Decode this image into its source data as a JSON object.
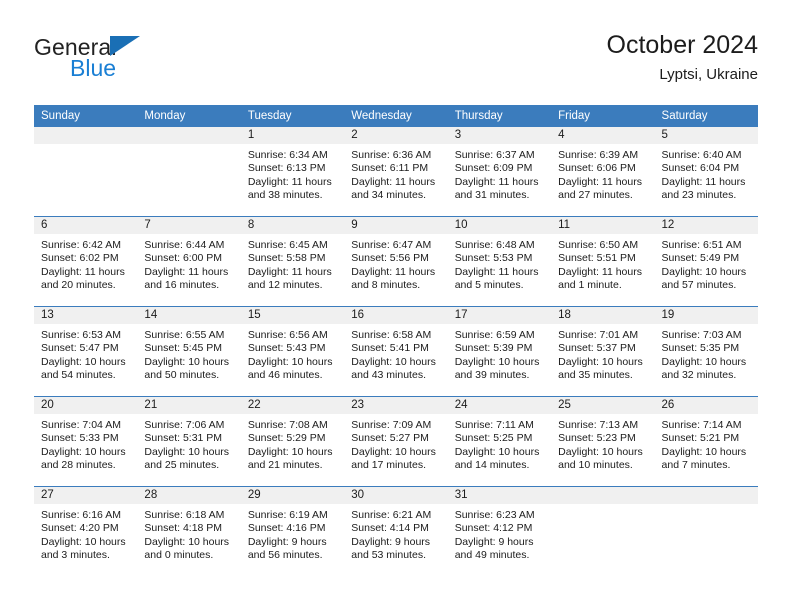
{
  "brand": {
    "name_top": "General",
    "name_bottom": "Blue",
    "triangle_color": "#1a6fb5",
    "blue_text_color": "#1a7fd4"
  },
  "header": {
    "title": "October 2024",
    "subtitle": "Lyptsi, Ukraine"
  },
  "theme": {
    "header_blue": "#3b7cbd",
    "daynum_band": "#f0f0f0",
    "text": "#1c1c1c"
  },
  "calendar": {
    "weekday_headers": [
      "Sunday",
      "Monday",
      "Tuesday",
      "Wednesday",
      "Thursday",
      "Friday",
      "Saturday"
    ],
    "labels": {
      "sunrise": "Sunrise:",
      "sunset": "Sunset:",
      "daylight": "Daylight:"
    },
    "weeks": [
      [
        {
          "day": ""
        },
        {
          "day": ""
        },
        {
          "day": "1",
          "sunrise": "Sunrise: 6:34 AM",
          "sunset": "Sunset: 6:13 PM",
          "daylight": "Daylight: 11 hours and 38 minutes."
        },
        {
          "day": "2",
          "sunrise": "Sunrise: 6:36 AM",
          "sunset": "Sunset: 6:11 PM",
          "daylight": "Daylight: 11 hours and 34 minutes."
        },
        {
          "day": "3",
          "sunrise": "Sunrise: 6:37 AM",
          "sunset": "Sunset: 6:09 PM",
          "daylight": "Daylight: 11 hours and 31 minutes."
        },
        {
          "day": "4",
          "sunrise": "Sunrise: 6:39 AM",
          "sunset": "Sunset: 6:06 PM",
          "daylight": "Daylight: 11 hours and 27 minutes."
        },
        {
          "day": "5",
          "sunrise": "Sunrise: 6:40 AM",
          "sunset": "Sunset: 6:04 PM",
          "daylight": "Daylight: 11 hours and 23 minutes."
        }
      ],
      [
        {
          "day": "6",
          "sunrise": "Sunrise: 6:42 AM",
          "sunset": "Sunset: 6:02 PM",
          "daylight": "Daylight: 11 hours and 20 minutes."
        },
        {
          "day": "7",
          "sunrise": "Sunrise: 6:44 AM",
          "sunset": "Sunset: 6:00 PM",
          "daylight": "Daylight: 11 hours and 16 minutes."
        },
        {
          "day": "8",
          "sunrise": "Sunrise: 6:45 AM",
          "sunset": "Sunset: 5:58 PM",
          "daylight": "Daylight: 11 hours and 12 minutes."
        },
        {
          "day": "9",
          "sunrise": "Sunrise: 6:47 AM",
          "sunset": "Sunset: 5:56 PM",
          "daylight": "Daylight: 11 hours and 8 minutes."
        },
        {
          "day": "10",
          "sunrise": "Sunrise: 6:48 AM",
          "sunset": "Sunset: 5:53 PM",
          "daylight": "Daylight: 11 hours and 5 minutes."
        },
        {
          "day": "11",
          "sunrise": "Sunrise: 6:50 AM",
          "sunset": "Sunset: 5:51 PM",
          "daylight": "Daylight: 11 hours and 1 minute."
        },
        {
          "day": "12",
          "sunrise": "Sunrise: 6:51 AM",
          "sunset": "Sunset: 5:49 PM",
          "daylight": "Daylight: 10 hours and 57 minutes."
        }
      ],
      [
        {
          "day": "13",
          "sunrise": "Sunrise: 6:53 AM",
          "sunset": "Sunset: 5:47 PM",
          "daylight": "Daylight: 10 hours and 54 minutes."
        },
        {
          "day": "14",
          "sunrise": "Sunrise: 6:55 AM",
          "sunset": "Sunset: 5:45 PM",
          "daylight": "Daylight: 10 hours and 50 minutes."
        },
        {
          "day": "15",
          "sunrise": "Sunrise: 6:56 AM",
          "sunset": "Sunset: 5:43 PM",
          "daylight": "Daylight: 10 hours and 46 minutes."
        },
        {
          "day": "16",
          "sunrise": "Sunrise: 6:58 AM",
          "sunset": "Sunset: 5:41 PM",
          "daylight": "Daylight: 10 hours and 43 minutes."
        },
        {
          "day": "17",
          "sunrise": "Sunrise: 6:59 AM",
          "sunset": "Sunset: 5:39 PM",
          "daylight": "Daylight: 10 hours and 39 minutes."
        },
        {
          "day": "18",
          "sunrise": "Sunrise: 7:01 AM",
          "sunset": "Sunset: 5:37 PM",
          "daylight": "Daylight: 10 hours and 35 minutes."
        },
        {
          "day": "19",
          "sunrise": "Sunrise: 7:03 AM",
          "sunset": "Sunset: 5:35 PM",
          "daylight": "Daylight: 10 hours and 32 minutes."
        }
      ],
      [
        {
          "day": "20",
          "sunrise": "Sunrise: 7:04 AM",
          "sunset": "Sunset: 5:33 PM",
          "daylight": "Daylight: 10 hours and 28 minutes."
        },
        {
          "day": "21",
          "sunrise": "Sunrise: 7:06 AM",
          "sunset": "Sunset: 5:31 PM",
          "daylight": "Daylight: 10 hours and 25 minutes."
        },
        {
          "day": "22",
          "sunrise": "Sunrise: 7:08 AM",
          "sunset": "Sunset: 5:29 PM",
          "daylight": "Daylight: 10 hours and 21 minutes."
        },
        {
          "day": "23",
          "sunrise": "Sunrise: 7:09 AM",
          "sunset": "Sunset: 5:27 PM",
          "daylight": "Daylight: 10 hours and 17 minutes."
        },
        {
          "day": "24",
          "sunrise": "Sunrise: 7:11 AM",
          "sunset": "Sunset: 5:25 PM",
          "daylight": "Daylight: 10 hours and 14 minutes."
        },
        {
          "day": "25",
          "sunrise": "Sunrise: 7:13 AM",
          "sunset": "Sunset: 5:23 PM",
          "daylight": "Daylight: 10 hours and 10 minutes."
        },
        {
          "day": "26",
          "sunrise": "Sunrise: 7:14 AM",
          "sunset": "Sunset: 5:21 PM",
          "daylight": "Daylight: 10 hours and 7 minutes."
        }
      ],
      [
        {
          "day": "27",
          "sunrise": "Sunrise: 6:16 AM",
          "sunset": "Sunset: 4:20 PM",
          "daylight": "Daylight: 10 hours and 3 minutes."
        },
        {
          "day": "28",
          "sunrise": "Sunrise: 6:18 AM",
          "sunset": "Sunset: 4:18 PM",
          "daylight": "Daylight: 10 hours and 0 minutes."
        },
        {
          "day": "29",
          "sunrise": "Sunrise: 6:19 AM",
          "sunset": "Sunset: 4:16 PM",
          "daylight": "Daylight: 9 hours and 56 minutes."
        },
        {
          "day": "30",
          "sunrise": "Sunrise: 6:21 AM",
          "sunset": "Sunset: 4:14 PM",
          "daylight": "Daylight: 9 hours and 53 minutes."
        },
        {
          "day": "31",
          "sunrise": "Sunrise: 6:23 AM",
          "sunset": "Sunset: 4:12 PM",
          "daylight": "Daylight: 9 hours and 49 minutes."
        },
        {
          "day": ""
        },
        {
          "day": ""
        }
      ]
    ]
  }
}
